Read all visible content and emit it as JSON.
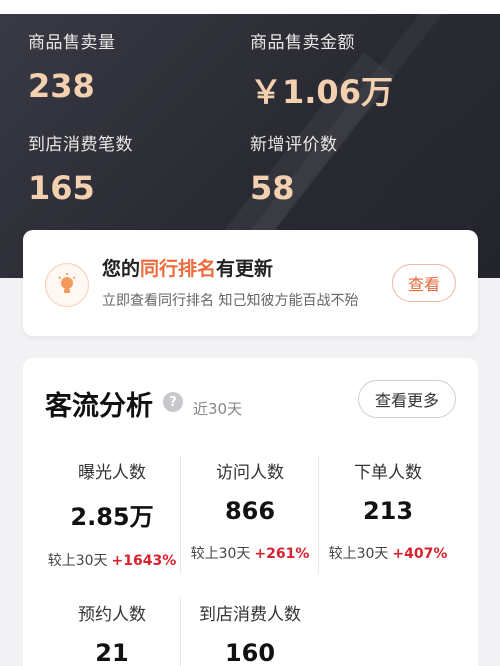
{
  "summary": {
    "items": [
      {
        "label": "商品售卖量",
        "value": "238"
      },
      {
        "label": "商品售卖金额",
        "value": "￥1.06万"
      },
      {
        "label": "到店消费笔数",
        "value": "165"
      },
      {
        "label": "新增评价数",
        "value": "58"
      }
    ]
  },
  "rank_card": {
    "title_prefix": "您的",
    "title_highlight": "同行排名",
    "title_suffix": "有更新",
    "subtitle": "立即查看同行排名 知己知彼方能百战不殆",
    "button_label": "查看",
    "icon": "lightbulb-icon",
    "accent": "#ec6b3c"
  },
  "traffic": {
    "title": "客流分析",
    "help_icon": "?",
    "range": "近30天",
    "more_label": "查看更多",
    "metrics": [
      {
        "label": "曝光人数",
        "value": "2.85万",
        "compare": "较上30天",
        "delta": "+1643%"
      },
      {
        "label": "访问人数",
        "value": "866",
        "compare": "较上30天",
        "delta": "+261%"
      },
      {
        "label": "下单人数",
        "value": "213",
        "compare": "较上30天",
        "delta": "+407%"
      },
      {
        "label": "预约人数",
        "value": "21"
      },
      {
        "label": "到店消费人数",
        "value": "160"
      }
    ],
    "delta_color": "#d7222f"
  }
}
